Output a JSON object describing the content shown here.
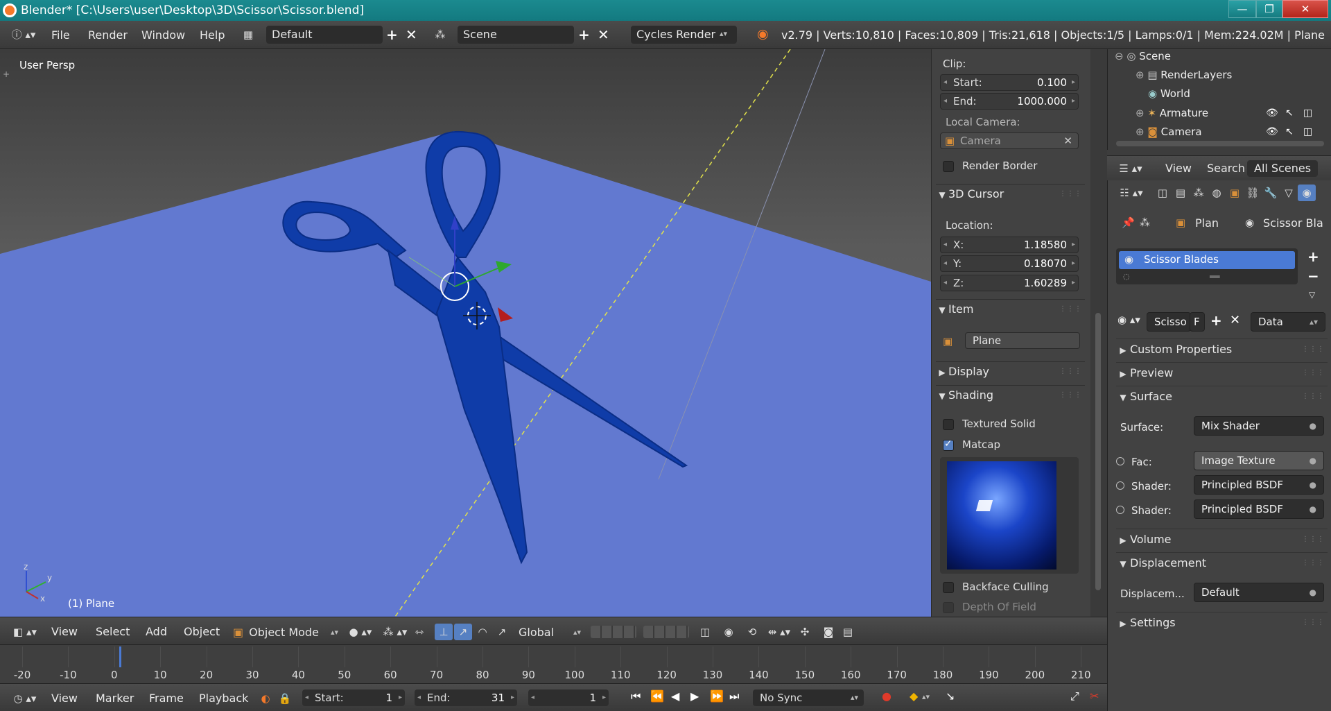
{
  "window": {
    "title": "Blender* [C:\\Users\\user\\Desktop\\3D\\Scissor\\Scissor.blend]",
    "minimize": "—",
    "maximize": "❐",
    "close": "✕"
  },
  "info_bar": {
    "menus": [
      "File",
      "Render",
      "Window",
      "Help"
    ],
    "layout": "Default",
    "scene": "Scene",
    "engine": "Cycles Render",
    "stats": "v2.79 | Verts:10,810 | Faces:10,809 | Tris:21,618 | Objects:1/5 | Lamps:0/1 | Mem:224.02M | Plane"
  },
  "viewport": {
    "label": "User Persp",
    "object_label": "(1) Plane",
    "axis": {
      "x": "x",
      "y": "y",
      "z": "z"
    }
  },
  "npanel": {
    "clip_label": "Clip:",
    "clip_start_label": "Start:",
    "clip_start": "0.100",
    "clip_end_label": "End:",
    "clip_end": "1000.000",
    "local_camera_label": "Local Camera:",
    "camera": "Camera",
    "render_border": "Render Border",
    "cursor_header": "3D Cursor",
    "location_label": "Location:",
    "x_label": "X:",
    "x": "1.18580",
    "y_label": "Y:",
    "y": "0.18070",
    "z_label": "Z:",
    "z": "1.60289",
    "item_header": "Item",
    "item_name": "Plane",
    "display_header": "Display",
    "shading_header": "Shading",
    "textured_solid": "Textured Solid",
    "matcap": "Matcap",
    "backface_culling": "Backface Culling",
    "depth_of_field": "Depth Of Field"
  },
  "outliner": {
    "items": [
      "Scene",
      "RenderLayers",
      "World",
      "Armature",
      "Camera"
    ]
  },
  "outliner_header": {
    "view": "View",
    "search": "Search",
    "all_scenes": "All Scenes"
  },
  "properties": {
    "breadcrumb_object": "Plan",
    "breadcrumb_material": "Scissor Bla",
    "material_slot": "Scissor Blades",
    "material_name": "Scisso",
    "fake_user": "F",
    "data": "Data",
    "sections": {
      "custom_properties": "Custom Properties",
      "preview": "Preview",
      "surface": "Surface",
      "volume": "Volume",
      "displacement": "Displacement",
      "settings": "Settings"
    },
    "surface_label": "Surface:",
    "surface_value": "Mix Shader",
    "fac_label": "Fac:",
    "fac_value": "Image Texture",
    "shader1_label": "Shader:",
    "shader1_value": "Principled BSDF",
    "shader2_label": "Shader:",
    "shader2_value": "Principled BSDF",
    "displacement_label": "Displacem...",
    "displacement_value": "Default"
  },
  "vp_header": {
    "menus": [
      "View",
      "Select",
      "Add",
      "Object"
    ],
    "mode": "Object Mode",
    "orientation": "Global"
  },
  "timeline": {
    "ticks": [
      "-20",
      "-10",
      "0",
      "10",
      "20",
      "30",
      "40",
      "50",
      "60",
      "70",
      "80",
      "90",
      "100",
      "110",
      "120",
      "130",
      "140",
      "150",
      "160",
      "170",
      "180",
      "190",
      "200",
      "210"
    ]
  },
  "tl_header": {
    "menus": [
      "View",
      "Marker",
      "Frame",
      "Playback"
    ],
    "start_label": "Start:",
    "start": "1",
    "end_label": "End:",
    "end": "31",
    "current": "1",
    "sync": "No Sync"
  },
  "colors": {
    "accent": "#5680c2",
    "plane": "#5f77cf",
    "scissors": "#0f3ca8"
  }
}
